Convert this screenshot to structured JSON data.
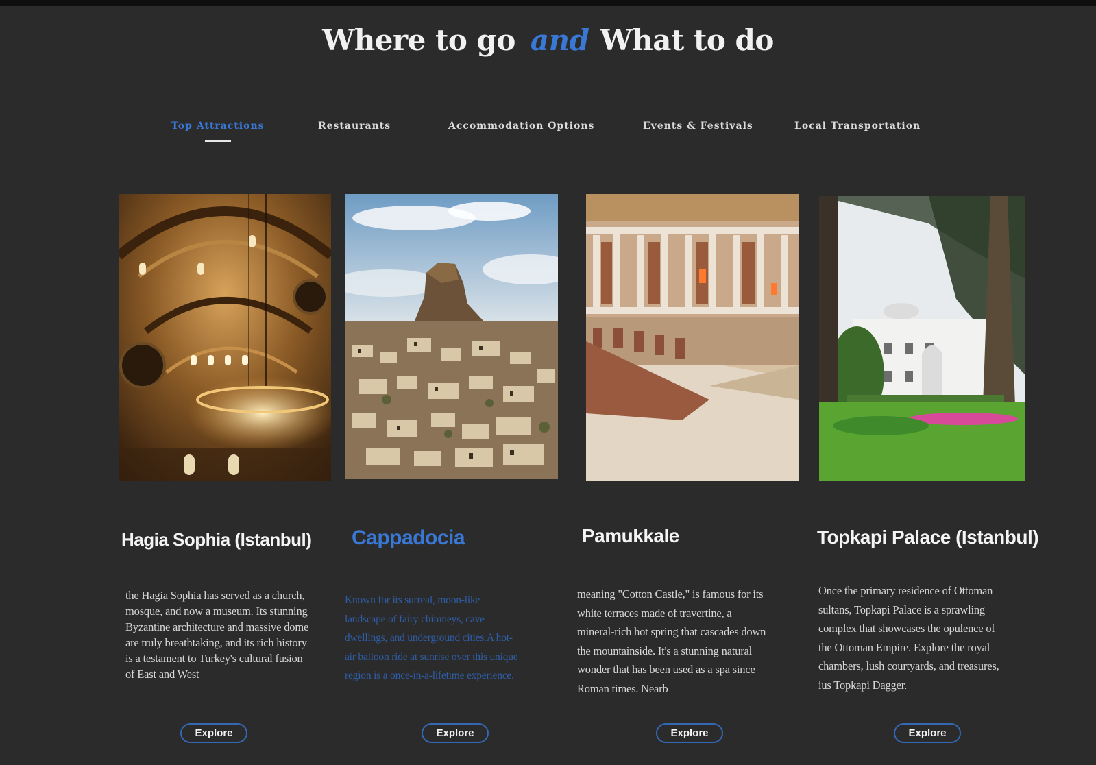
{
  "header": {
    "title_part1": "Where to go",
    "title_and": "and",
    "title_part2": "What to do"
  },
  "tabs": [
    {
      "label": "Top Attractions",
      "active": true
    },
    {
      "label": "Restaurants",
      "active": false
    },
    {
      "label": "Accommodation Options",
      "active": false
    },
    {
      "label": "Events & Festivals",
      "active": false
    },
    {
      "label": "Local Transportation",
      "active": false
    }
  ],
  "colors": {
    "accent": "#3a78d6",
    "background": "#2b2b2c",
    "button_border": "#3568b4"
  },
  "cards": [
    {
      "title": "Hagia Sophia (Istanbul)",
      "image": "hagia-sophia-interior-photo",
      "description_lines": [
        "the Hagia Sophia has served as a church,",
        "mosque, and now a museum. Its stunning",
        "Byzantine architecture and massive dome",
        "are truly breathtaking, and its rich history",
        "is a testament to Turkey's cultural fusion",
        "of East and West"
      ],
      "button": "Explore"
    },
    {
      "title": "Cappadocia",
      "image": "cappadocia-rock-village-photo",
      "description_lines": [
        "Known for its surreal, moon-like",
        "landscape of fairy chimneys, cave",
        "dwellings, and underground cities.A hot-",
        "air balloon ride at sunrise over this unique",
        "region is a once-in-a-lifetime experience."
      ],
      "button": "Explore"
    },
    {
      "title": "Pamukkale",
      "image": "ancient-theatre-ruins-photo",
      "description_lines": [
        "meaning \"Cotton Castle,\" is famous for its",
        "white terraces made of travertine, a",
        "mineral-rich hot spring that cascades down",
        "the mountainside. It's a stunning natural",
        "wonder that has been used as a spa since",
        "Roman times. Nearb"
      ],
      "button": "Explore"
    },
    {
      "title": "Topkapi Palace (Istanbul)",
      "image": "topkapi-palace-garden-photo",
      "description_lines": [
        "Once the primary residence of Ottoman",
        "sultans, Topkapi Palace is a sprawling",
        "complex that showcases the opulence of",
        "the Ottoman Empire. Explore the royal",
        "chambers, lush courtyards, and treasures,",
        "ius Topkapi Dagger."
      ],
      "button": "Explore"
    }
  ]
}
